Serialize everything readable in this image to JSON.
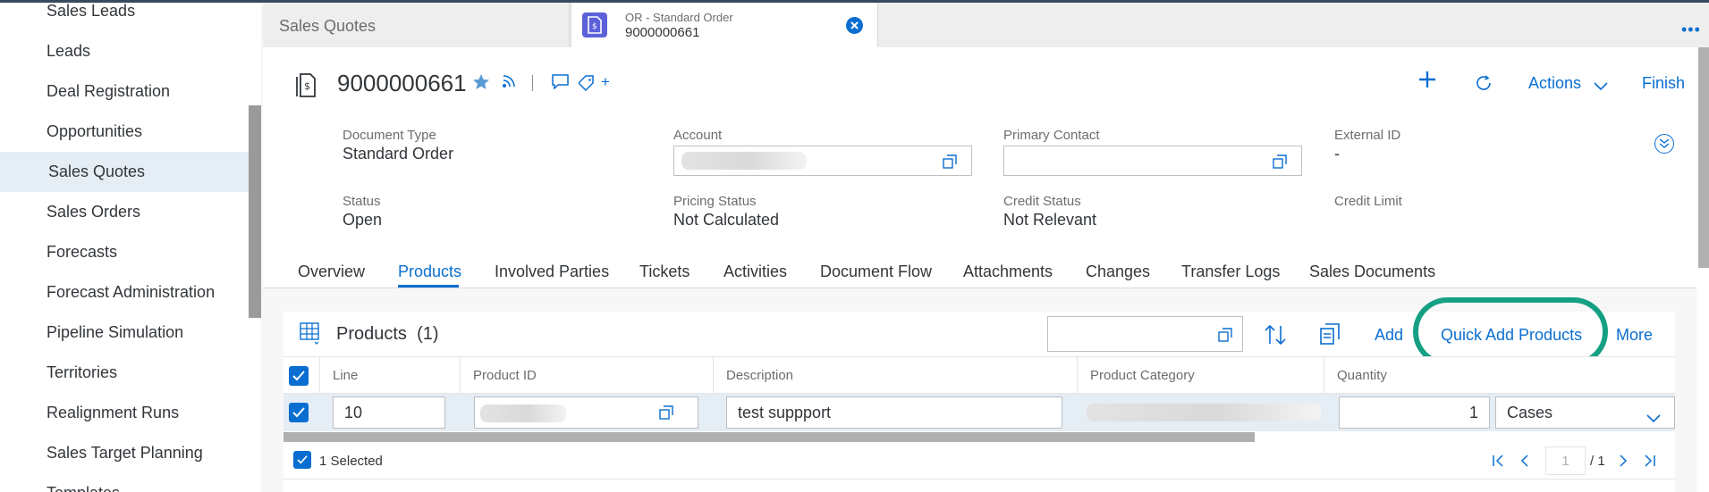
{
  "sidebar": {
    "items": [
      {
        "label": "Sales Leads"
      },
      {
        "label": "Leads"
      },
      {
        "label": "Deal Registration"
      },
      {
        "label": "Opportunities"
      },
      {
        "label": "Sales Quotes",
        "active": true
      },
      {
        "label": "Sales Orders"
      },
      {
        "label": "Forecasts"
      },
      {
        "label": "Forecast Administration"
      },
      {
        "label": "Pipeline Simulation"
      },
      {
        "label": "Territories"
      },
      {
        "label": "Realignment Runs"
      },
      {
        "label": "Sales Target Planning"
      },
      {
        "label": "Templates"
      }
    ]
  },
  "tabs": {
    "first": "Sales Quotes",
    "second_sub": "OR - Standard Order",
    "second_main": "9000000661"
  },
  "header": {
    "title": "9000000661",
    "plus_small": "+",
    "actions": "Actions",
    "finish": "Finish"
  },
  "fields": {
    "document_type": {
      "label": "Document Type",
      "value": "Standard Order"
    },
    "account": {
      "label": "Account"
    },
    "primary_contact": {
      "label": "Primary Contact"
    },
    "external_id": {
      "label": "External ID",
      "value": "-"
    },
    "status": {
      "label": "Status",
      "value": "Open"
    },
    "pricing_status": {
      "label": "Pricing Status",
      "value": "Not Calculated"
    },
    "credit_status": {
      "label": "Credit Status",
      "value": "Not Relevant"
    },
    "credit_limit": {
      "label": "Credit Limit"
    }
  },
  "object_tabs": [
    "Overview",
    "Products",
    "Involved Parties",
    "Tickets",
    "Activities",
    "Document Flow",
    "Attachments",
    "Changes",
    "Transfer Logs",
    "Sales Documents"
  ],
  "products": {
    "title": "Products",
    "count": "(1)",
    "add": "Add",
    "quick_add": "Quick Add Products",
    "more": "More",
    "columns": {
      "line": "Line",
      "product_id": "Product ID",
      "description": "Description",
      "product_category": "Product Category",
      "quantity": "Quantity"
    },
    "row": {
      "line": "10",
      "description": "test suppport",
      "quantity": "1",
      "unit": "Cases"
    },
    "selected": "1 Selected",
    "pager": {
      "page": "1",
      "total": "/ 1"
    }
  },
  "colors": {
    "accent": "#0a6ed1",
    "highlight": "#16a083",
    "doc_icon": "#5c61d9"
  }
}
